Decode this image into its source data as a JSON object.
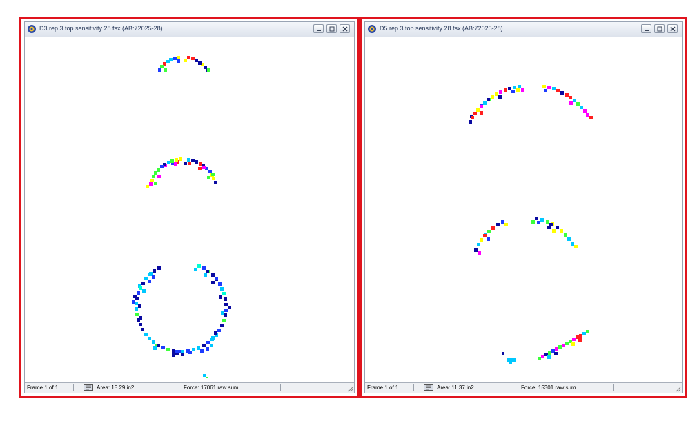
{
  "windows": [
    {
      "title": "D3 rep 3 top sensitivity 28.fsx (AB:72025-28)",
      "frame": "Frame 1 of 1",
      "area": "Area: 15.29 in2",
      "force": "Force: 17061 raw sum"
    },
    {
      "title": "D5 rep 3 top sensitivity 28.fsx (AB:72025-28)",
      "frame": "Frame 1 of 1",
      "area": "Area: 11.37 in2",
      "force": "Force: 15301 raw sum"
    }
  ],
  "colors": {
    "frame_outline": "#e0141e",
    "pressure_palette": [
      "#0a0aa0",
      "#1e3cff",
      "#00c8ff",
      "#00ffd2",
      "#3cff3c",
      "#ffff00",
      "#ff2020",
      "#ff00ff"
    ]
  },
  "icons": [
    "app-icon",
    "minimize-icon",
    "maximize-icon",
    "close-icon",
    "map-icon",
    "resize-grip-icon"
  ]
}
